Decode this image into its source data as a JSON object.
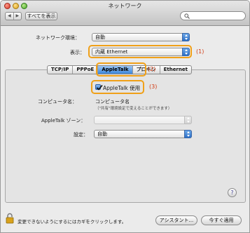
{
  "window": {
    "title": "ネットワーク"
  },
  "toolbar": {
    "back_glyph": "◀",
    "forward_glyph": "▶",
    "show_all_label": "すべてを表示",
    "search_placeholder": ""
  },
  "form": {
    "environment_label": "ネットワーク環境：",
    "environment_value": "自動",
    "show_label": "表示：",
    "show_value": "内蔵 Ethernet"
  },
  "tabs": [
    "TCP/IP",
    "PPPoE",
    "AppleTalk",
    "プロキシ",
    "Ethernet"
  ],
  "active_tab": "AppleTalk",
  "appletalk": {
    "use_label": "AppleTalk 使用",
    "use_checked": true,
    "computer_name_label": "コンピュータ名：",
    "computer_name_value": "コンピュータ名",
    "computer_name_note": "（\"共有\"環境設定で変えることができます）",
    "zone_label": "AppleTalk ゾーン：",
    "zone_value": "",
    "config_label": "設定：",
    "config_value": "自動"
  },
  "callouts": [
    "(1)",
    "(2)",
    "(3)"
  ],
  "help_glyph": "?",
  "footer": {
    "lock_text": "変更できないようにするにはカギをクリックします。",
    "assistant_label": "アシスタント...",
    "apply_label": "今すぐ適用"
  },
  "colors": {
    "highlight": "#f0a018",
    "callout_text": "#d23a12",
    "active_tab": "#3a86dc"
  },
  "icons": [
    "close-button-icon",
    "minimize-button-icon",
    "zoom-button-icon",
    "search-icon",
    "checkmark-icon",
    "help-icon",
    "lock-icon"
  ]
}
